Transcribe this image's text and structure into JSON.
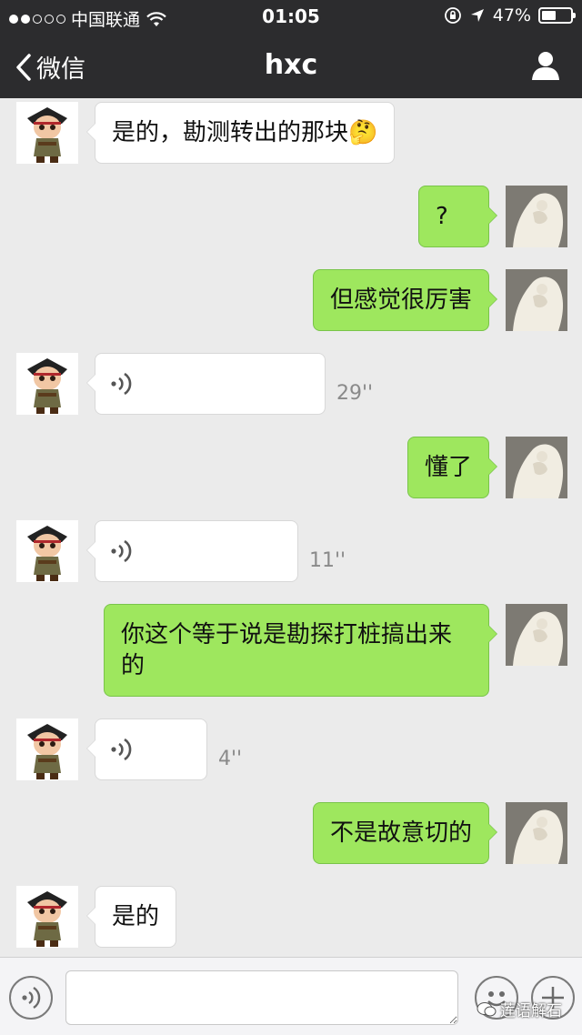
{
  "status_bar": {
    "carrier": "中国联通",
    "time": "01:05",
    "battery": "47%"
  },
  "nav": {
    "back_label": "微信",
    "title": "hxc"
  },
  "messages": [
    {
      "side": "in",
      "type": "text",
      "text": "是的，勘测转出的那块🤔"
    },
    {
      "side": "out",
      "type": "text",
      "text": "?"
    },
    {
      "side": "out",
      "type": "text",
      "text": "但感觉很厉害"
    },
    {
      "side": "in",
      "type": "voice",
      "duration": "29''"
    },
    {
      "side": "out",
      "type": "text",
      "text": "懂了"
    },
    {
      "side": "in",
      "type": "voice",
      "duration": "11''"
    },
    {
      "side": "out",
      "type": "text",
      "text": "你这个等于说是勘探打桩搞出来的"
    },
    {
      "side": "in",
      "type": "voice",
      "duration": "4''"
    },
    {
      "side": "out",
      "type": "text",
      "text": "不是故意切的"
    },
    {
      "side": "in",
      "type": "text",
      "text": "是的"
    }
  ],
  "input_bar": {
    "text_value": "",
    "watermark": "莲语解石"
  },
  "icons": {
    "back": "chevron-left-icon",
    "profile": "person-icon",
    "voice": "voice-icon",
    "emoji": "emoji-icon",
    "more": "plus-icon"
  },
  "colors": {
    "nav_bg": "#2c2c2e",
    "chat_bg": "#ebebeb",
    "outgoing_bubble": "#9ee75e",
    "incoming_bubble": "#ffffff"
  }
}
